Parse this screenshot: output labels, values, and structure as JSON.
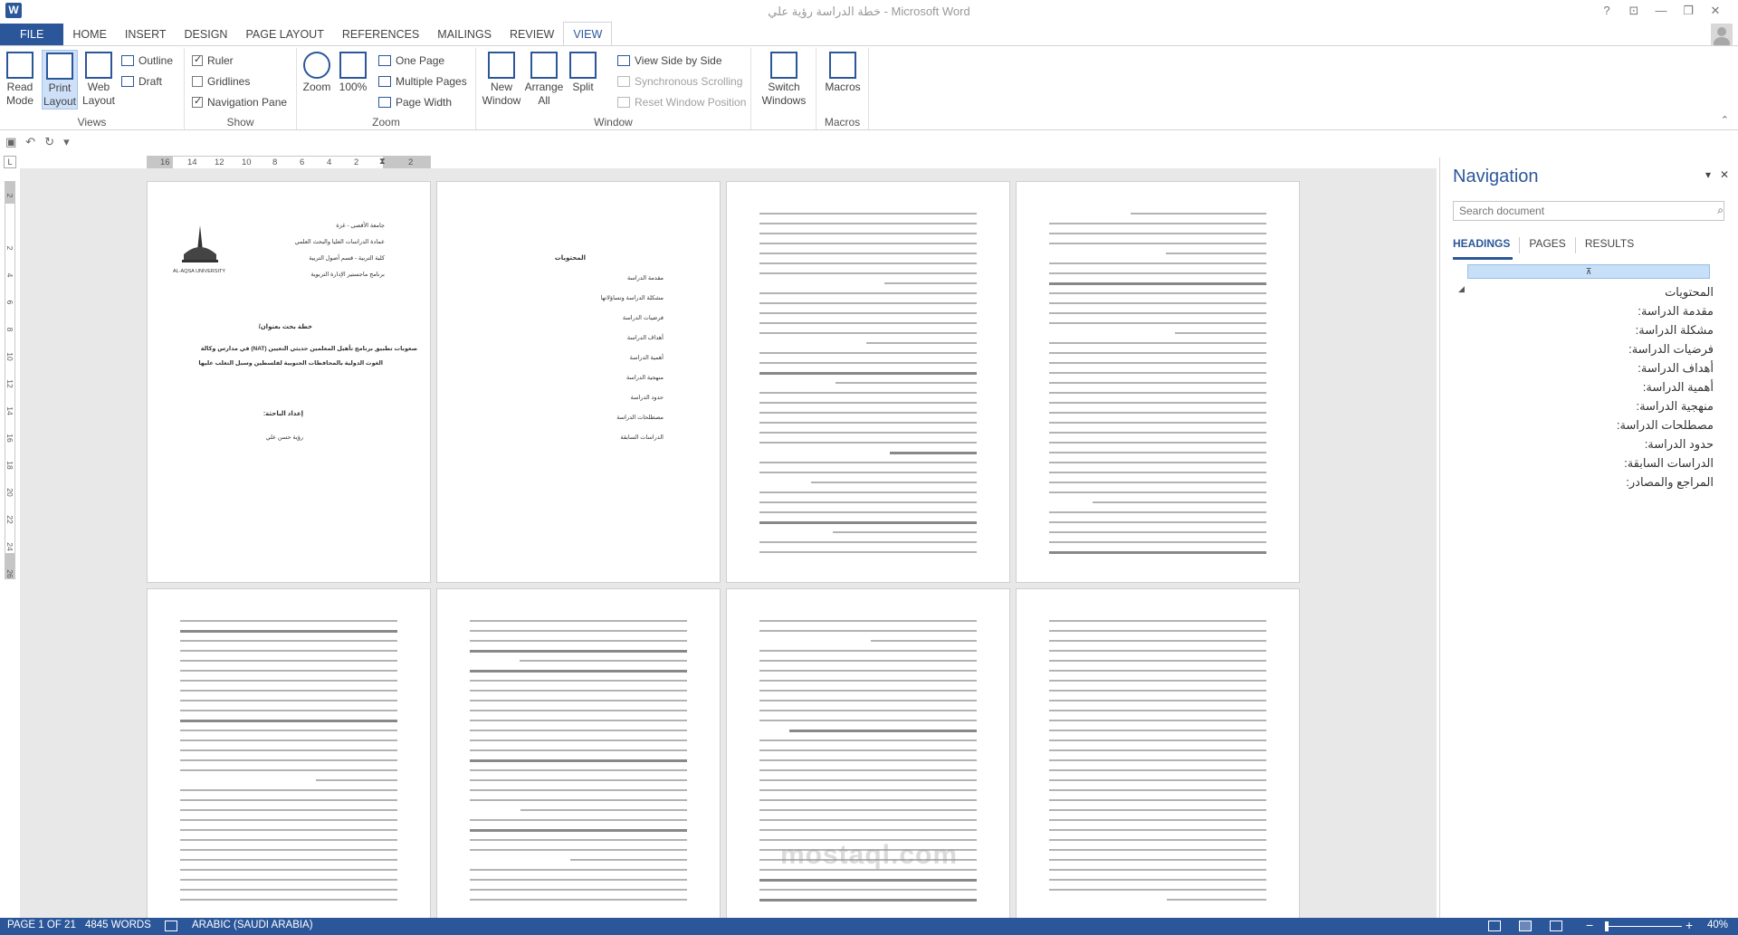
{
  "window": {
    "title": "خطة الدراسة رؤية علي - Microsoft Word",
    "app_icon": "W",
    "help": "?",
    "ribbon_display": "⊡",
    "minimize": "—",
    "maximize": "❐",
    "close": "✕"
  },
  "tabs": [
    "FILE",
    "HOME",
    "INSERT",
    "DESIGN",
    "PAGE LAYOUT",
    "REFERENCES",
    "MAILINGS",
    "REVIEW",
    "VIEW"
  ],
  "active_tab": "VIEW",
  "ribbon": {
    "views": {
      "label": "Views",
      "read_mode": "Read Mode",
      "print_layout": "Print Layout",
      "web_layout": "Web Layout",
      "outline": "Outline",
      "draft": "Draft"
    },
    "show": {
      "label": "Show",
      "ruler": "Ruler",
      "gridlines": "Gridlines",
      "navigation_pane": "Navigation Pane",
      "ruler_checked": true,
      "gridlines_checked": false,
      "navigation_pane_checked": true
    },
    "zoom": {
      "label": "Zoom",
      "zoom": "Zoom",
      "hundred": "100%",
      "one_page": "One Page",
      "multiple_pages": "Multiple Pages",
      "page_width": "Page Width"
    },
    "window": {
      "label": "Window",
      "new_window": "New Window",
      "arrange_all": "Arrange All",
      "split": "Split",
      "side_by_side": "View Side by Side",
      "sync_scrolling": "Synchronous Scrolling",
      "reset_position": "Reset Window Position",
      "switch_windows": "Switch Windows"
    },
    "macros": {
      "label": "Macros",
      "macros": "Macros"
    }
  },
  "ruler": {
    "corner": "L",
    "h_numbers": [
      "16",
      "14",
      "12",
      "10",
      "8",
      "6",
      "4",
      "2",
      "2"
    ],
    "v_numbers": [
      "2",
      "2",
      "4",
      "6",
      "8",
      "10",
      "12",
      "14",
      "16",
      "18",
      "20",
      "22",
      "24",
      "26"
    ]
  },
  "pages": {
    "cover": {
      "university": "جامعة الأقصى - غزة",
      "dean": "عمادة الدراسات العليا والبحث العلمي",
      "faculty": "كلية التربية - قسم أصول التربية",
      "program": "برنامج ماجستير الإدارة التربوية",
      "logo_text": "AL-AQSA UNIVERSITY",
      "plan_title": "خطة بحث بعنوان/",
      "research_title_1": "صعوبات تطبيق برنامج تأهيل المعلمين حديثي التعيين (NAT) في مدارس وكالة",
      "research_title_2": "الغوث الدولية بالمحافظات الجنوبية لفلسطين وسبل التغلب عليها",
      "prepared_by": "إعداد الباحثة:",
      "author": "رؤية حسن علي"
    },
    "toc": {
      "title": "المحتويات",
      "items": [
        "مقدمة الدراسة",
        "مشكلة الدراسة وتساؤلاتها",
        "فرضيات الدراسة",
        "أهداف الدراسة",
        "أهمية الدراسة",
        "منهجية الدراسة",
        "حدود الدراسة",
        "مصطلحات الدراسة",
        "الدراسات السابقة"
      ]
    }
  },
  "watermark": "mostaql.com",
  "navigation": {
    "title": "Navigation",
    "menu": "▾",
    "close": "✕",
    "search_placeholder": "Search document",
    "search_icon": "⌕",
    "tabs": [
      "HEADINGS",
      "PAGES",
      "RESULTS"
    ],
    "active_tab": "HEADINGS",
    "top_marker": "⊼",
    "collapse_marker": "◢",
    "headings": [
      "المحتويات",
      "مقدمة الدراسة:",
      "مشكلة الدراسة:",
      "فرضيات الدراسة:",
      "أهداف الدراسة:",
      "أهمية الدراسة:",
      "منهجية الدراسة:",
      "مصطلحات الدراسة:",
      "حدود الدراسة:",
      "الدراسات السابقة:",
      "المراجع والمصادر:"
    ]
  },
  "status": {
    "page": "PAGE 1 OF 21",
    "words": "4845 WORDS",
    "language": "ARABIC (SAUDI ARABIA)",
    "zoom_minus": "−",
    "zoom_plus": "+",
    "zoom": "40%"
  },
  "colors": {
    "accent": "#2b579a",
    "status_bar": "#2b579a",
    "selected_button": "#cde0f7"
  }
}
